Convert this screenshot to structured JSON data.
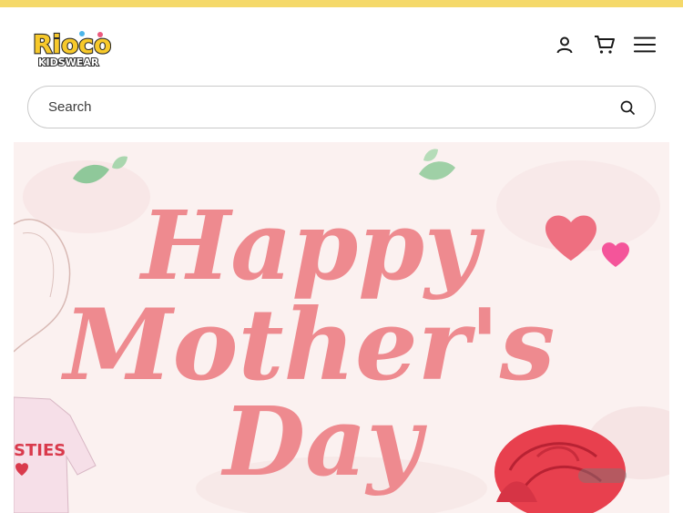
{
  "brand": {
    "logo_line1": "Rioco",
    "logo_line2": "KIDSWEAR"
  },
  "header": {
    "icons": [
      "account-icon",
      "cart-icon",
      "menu-icon"
    ]
  },
  "search": {
    "placeholder": "Search"
  },
  "banner": {
    "headline_line1": "Happy",
    "headline_line2": "Mother's",
    "headline_line3": "Day",
    "shirt_text": "STIES"
  },
  "colors": {
    "top_bar": "#f5d96a",
    "script_pink": "#ee8a8f",
    "rose_red": "#e8404e",
    "leaf_green": "#8fc89a"
  }
}
